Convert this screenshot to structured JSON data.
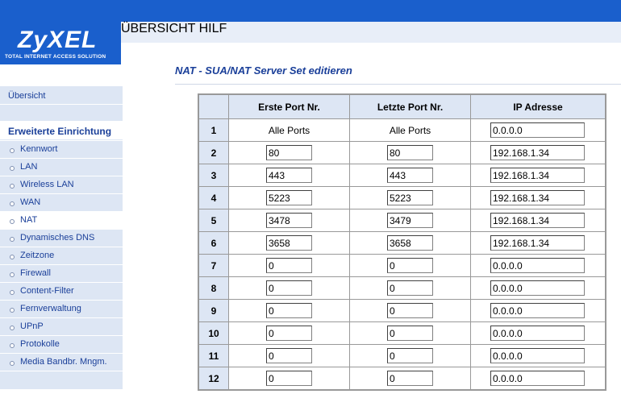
{
  "brand": {
    "name": "ZyXEL",
    "tagline": "Total Internet Access Solution"
  },
  "topnav": {
    "overview": "ÜBERSICHT",
    "help": "HILF"
  },
  "sidebar": {
    "overview": "Übersicht",
    "section_title": "Erweiterte Einrichtung",
    "items": [
      {
        "label": "Kennwort"
      },
      {
        "label": "LAN"
      },
      {
        "label": "Wireless LAN"
      },
      {
        "label": "WAN"
      },
      {
        "label": "NAT"
      },
      {
        "label": "Dynamisches DNS"
      },
      {
        "label": "Zeitzone"
      },
      {
        "label": "Firewall"
      },
      {
        "label": "Content-Filter"
      },
      {
        "label": "Fernverwaltung"
      },
      {
        "label": "UPnP"
      },
      {
        "label": "Protokolle"
      },
      {
        "label": "Media Bandbr. Mngm."
      }
    ],
    "active_item": "NAT"
  },
  "page": {
    "title": "NAT - SUA/NAT Server Set editieren"
  },
  "table": {
    "headers": {
      "num": "",
      "first_port": "Erste Port Nr.",
      "last_port": "Letzte Port Nr.",
      "ip": "IP Adresse"
    },
    "rows": [
      {
        "num": "1",
        "first": "Alle Ports",
        "last": "Alle Ports",
        "ip": "0.0.0.0"
      },
      {
        "num": "2",
        "first": "80",
        "last": "80",
        "ip": "192.168.1.34"
      },
      {
        "num": "3",
        "first": "443",
        "last": "443",
        "ip": "192.168.1.34"
      },
      {
        "num": "4",
        "first": "5223",
        "last": "5223",
        "ip": "192.168.1.34"
      },
      {
        "num": "5",
        "first": "3478",
        "last": "3479",
        "ip": "192.168.1.34"
      },
      {
        "num": "6",
        "first": "3658",
        "last": "3658",
        "ip": "192.168.1.34"
      },
      {
        "num": "7",
        "first": "0",
        "last": "0",
        "ip": "0.0.0.0"
      },
      {
        "num": "8",
        "first": "0",
        "last": "0",
        "ip": "0.0.0.0"
      },
      {
        "num": "9",
        "first": "0",
        "last": "0",
        "ip": "0.0.0.0"
      },
      {
        "num": "10",
        "first": "0",
        "last": "0",
        "ip": "0.0.0.0"
      },
      {
        "num": "11",
        "first": "0",
        "last": "0",
        "ip": "0.0.0.0"
      },
      {
        "num": "12",
        "first": "0",
        "last": "0",
        "ip": "0.0.0.0"
      }
    ]
  },
  "colors": {
    "brand_blue": "#1a5fcc",
    "nav_bg": "#dde6f4",
    "title_blue": "#1a3f99"
  }
}
